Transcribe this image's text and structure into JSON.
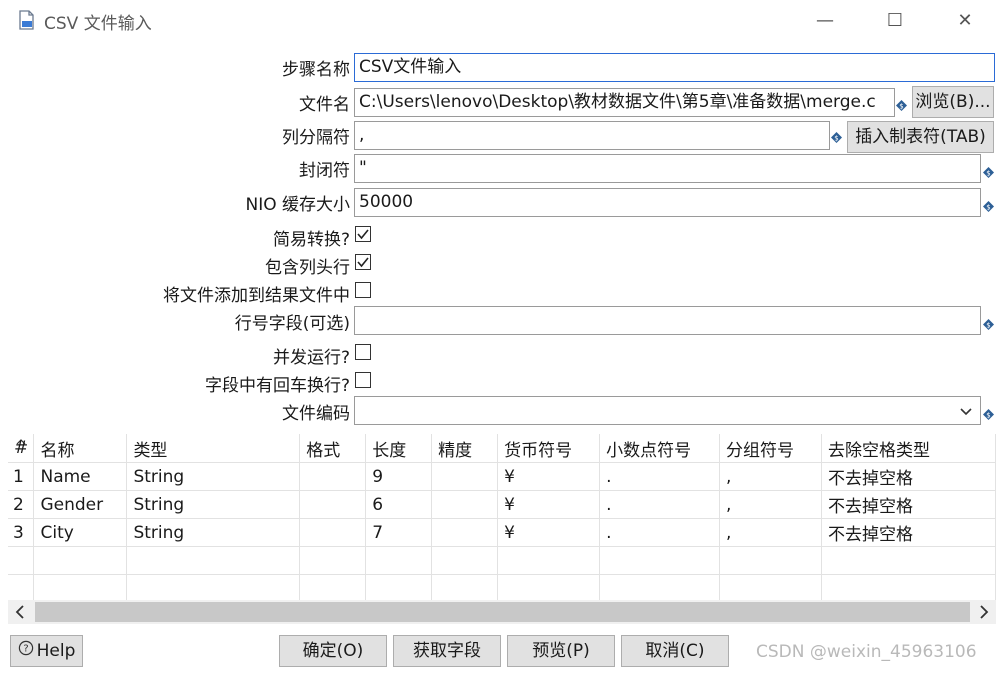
{
  "window": {
    "title": "CSV 文件输入",
    "minimize": "—",
    "maximize": "☐",
    "close": "✕"
  },
  "form": {
    "step_name_label": "步骤名称",
    "step_name_value": "CSV文件输入",
    "filename_label": "文件名",
    "filename_value": "C:\\Users\\lenovo\\Desktop\\教材数据文件\\第5章\\准备数据\\merge.c",
    "browse_button": "浏览(B)...",
    "delimiter_label": "列分隔符",
    "delimiter_value": ",",
    "insert_tab_button": "插入制表符(TAB)",
    "enclosure_label": "封闭符",
    "enclosure_value": "\"",
    "nio_label": "NIO 缓存大小",
    "nio_value": "50000",
    "lazy_label": "简易转换?",
    "lazy_checked": true,
    "header_label": "包含列头行",
    "header_checked": true,
    "add_result_label": "将文件添加到结果文件中",
    "add_result_checked": false,
    "rownum_label": "行号字段(可选)",
    "rownum_value": "",
    "parallel_label": "并发运行?",
    "parallel_checked": false,
    "newline_label": "字段中有回车换行?",
    "newline_checked": false,
    "encoding_label": "文件编码",
    "encoding_value": ""
  },
  "table": {
    "columns": [
      "#",
      "名称",
      "类型",
      "格式",
      "长度",
      "精度",
      "货币符号",
      "小数点符号",
      "分组符号",
      "去除空格类型"
    ],
    "rows": [
      [
        "1",
        "Name",
        "String",
        "",
        "9",
        "",
        "¥",
        ".",
        ",",
        "不去掉空格"
      ],
      [
        "2",
        "Gender",
        "String",
        "",
        "6",
        "",
        "¥",
        ".",
        ",",
        "不去掉空格"
      ],
      [
        "3",
        "City",
        "String",
        "",
        "7",
        "",
        "¥",
        ".",
        ",",
        "不去掉空格"
      ]
    ]
  },
  "footer": {
    "help_button": "Help",
    "ok_button": "确定(O)",
    "get_fields_button": "获取字段",
    "preview_button": "预览(P)",
    "cancel_button": "取消(C)",
    "watermark": "CSDN @weixin_45963106"
  }
}
